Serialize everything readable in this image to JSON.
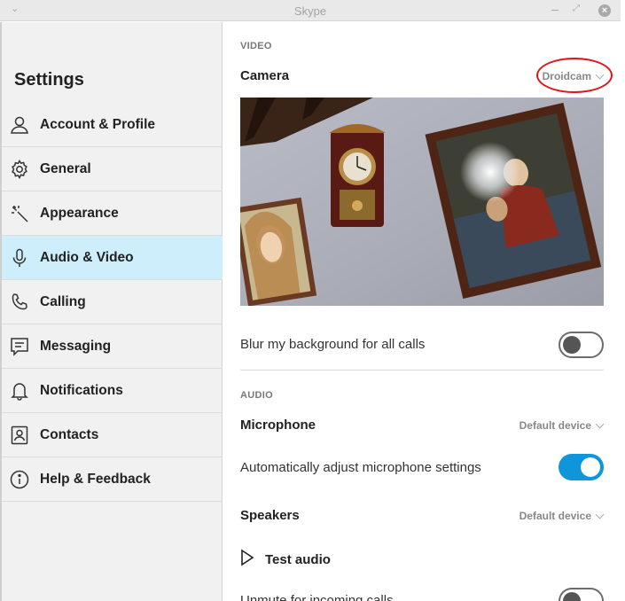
{
  "window": {
    "title": "Skype"
  },
  "sidebar": {
    "heading": "Settings",
    "items": [
      {
        "label": "Account & Profile",
        "icon": "person-icon",
        "active": false
      },
      {
        "label": "General",
        "icon": "gear-icon",
        "active": false
      },
      {
        "label": "Appearance",
        "icon": "magic-wand-icon",
        "active": false
      },
      {
        "label": "Audio & Video",
        "icon": "microphone-icon",
        "active": true
      },
      {
        "label": "Calling",
        "icon": "phone-icon",
        "active": false
      },
      {
        "label": "Messaging",
        "icon": "chat-icon",
        "active": false
      },
      {
        "label": "Notifications",
        "icon": "bell-icon",
        "active": false
      },
      {
        "label": "Contacts",
        "icon": "contact-card-icon",
        "active": false
      },
      {
        "label": "Help & Feedback",
        "icon": "info-icon",
        "active": false
      }
    ]
  },
  "video": {
    "section_label": "VIDEO",
    "camera_label": "Camera",
    "camera_value": "Droidcam",
    "blur_label": "Blur my background for all calls",
    "blur_enabled": false
  },
  "audio": {
    "section_label": "AUDIO",
    "microphone_label": "Microphone",
    "microphone_value": "Default device",
    "auto_adjust_label": "Automatically adjust microphone settings",
    "auto_adjust_enabled": true,
    "speakers_label": "Speakers",
    "speakers_value": "Default device",
    "test_audio_label": "Test audio",
    "unmute_label": "Unmute for incoming calls",
    "unmute_enabled": false
  },
  "colors": {
    "accent": "#0d96d9",
    "active_nav": "#cfeefc",
    "annotation_ring": "#e0141a"
  }
}
